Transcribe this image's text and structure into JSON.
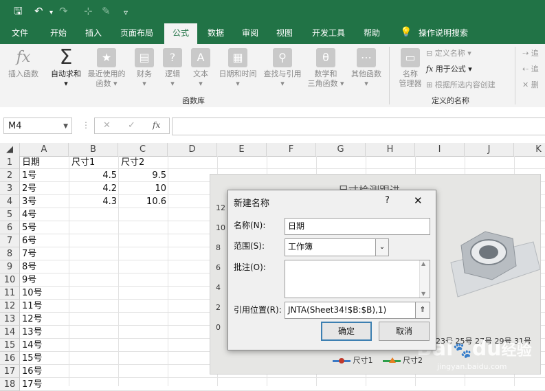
{
  "quick_access": {
    "customize": "▿"
  },
  "tabs": [
    {
      "label": "文件"
    },
    {
      "label": "开始"
    },
    {
      "label": "插入"
    },
    {
      "label": "页面布局"
    },
    {
      "label": "公式",
      "active": true
    },
    {
      "label": "数据"
    },
    {
      "label": "审阅"
    },
    {
      "label": "视图"
    },
    {
      "label": "开发工具"
    },
    {
      "label": "帮助"
    },
    {
      "label": "操作说明搜索"
    }
  ],
  "ribbon": {
    "insert_function": "插入函数",
    "autosum": "自动求和",
    "recent_1": "最近使用的",
    "recent_2": "函数",
    "financial": "财务",
    "logical": "逻辑",
    "text": "文本",
    "datetime": "日期和时间",
    "lookup": "查找与引用",
    "math_1": "数学和",
    "math_2": "三角函数",
    "more": "其他函数",
    "group_library": "函数库",
    "name_manager_1": "名称",
    "name_manager_2": "管理器",
    "define_name": "定义名称",
    "use_in_formula": "用于公式",
    "create_from_sel": "根据所选内容创建",
    "group_defined": "定义的名称",
    "trace_1": "追",
    "trace_2": "追",
    "trace_3": "删"
  },
  "formula_bar": {
    "name_box": "M4",
    "fx": "fx"
  },
  "columns": [
    "A",
    "B",
    "C",
    "D",
    "E",
    "F",
    "G",
    "H",
    "I",
    "J",
    "K"
  ],
  "rows": [
    "1",
    "2",
    "3",
    "4",
    "5",
    "6",
    "7",
    "8",
    "9",
    "10",
    "11",
    "12",
    "13",
    "14",
    "15",
    "16",
    "17",
    "18"
  ],
  "sheet": {
    "headers": [
      "日期",
      "尺寸1",
      "尺寸2"
    ],
    "colA": [
      "1号",
      "2号",
      "3号",
      "4号",
      "5号",
      "6号",
      "7号",
      "8号",
      "9号",
      "10号",
      "11号",
      "12号",
      "13号",
      "14号",
      "15号",
      "16号",
      "17号"
    ],
    "colB": [
      "4.5",
      "4.2",
      "4.3"
    ],
    "colC": [
      "9.5",
      "10",
      "10.6"
    ]
  },
  "chart": {
    "title": "尺寸检测跟进",
    "y_ticks": [
      "12",
      "10",
      "8",
      "6",
      "4",
      "2",
      "0"
    ],
    "x_ticks": "23号 25号 27号 29号 31号",
    "legend_1": "尺寸1",
    "legend_2": "尺寸2",
    "series_1_color": "#c0392b",
    "series_2_color": "#e67e22",
    "watermark_1": "Bai",
    "watermark_2": "du",
    "watermark_3": "经验",
    "watermark_url": "jingyan.baidu.com"
  },
  "dialog": {
    "title": "新建名称",
    "help": "?",
    "close": "✕",
    "name_label": "名称(N):",
    "name_value": "日期",
    "scope_label": "范围(S):",
    "scope_value": "工作簿",
    "comment_label": "批注(O):",
    "ref_label": "引用位置(R):",
    "ref_value": "JNTA(Sheet34!$B:$B),1)",
    "ok": "确定",
    "cancel": "取消"
  }
}
